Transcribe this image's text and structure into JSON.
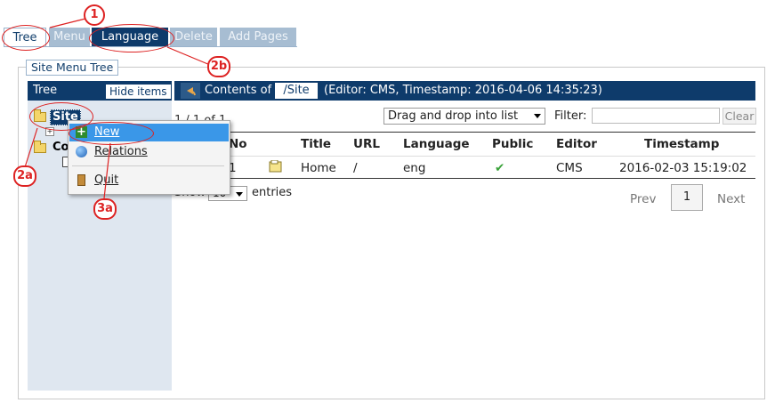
{
  "tabs": [
    {
      "label": "Tree"
    },
    {
      "label": "Menu"
    },
    {
      "label": "Language"
    },
    {
      "label": "Delete"
    },
    {
      "label": "Add Pages"
    }
  ],
  "panel": {
    "legend": "Site Menu Tree"
  },
  "sidebar": {
    "title": "Tree",
    "hide_button": "Hide items"
  },
  "tree": {
    "root": "Site",
    "second": "Co"
  },
  "contents": {
    "prefix": "Contents of",
    "path": "/Site",
    "suffix": "(Editor: CMS, Timestamp: 2016-04-06 14:35:23)"
  },
  "toolbar": {
    "count": "1 / 1 of 1",
    "mode_select": "Drag and drop into list",
    "filter_label": "Filter:",
    "filter_value": "",
    "clear_button": "Clear"
  },
  "table": {
    "columns": [
      "No",
      "Title",
      "URL",
      "Language",
      "Public",
      "Editor",
      "Timestamp"
    ],
    "rows": [
      {
        "no": "1",
        "title": "Home",
        "url": "/",
        "language": "eng",
        "public": "✔",
        "editor": "CMS",
        "timestamp": "2016-02-03 15:19:02"
      }
    ]
  },
  "footer": {
    "show": "Show",
    "length": "10",
    "entries": "entries",
    "prev": "Prev",
    "page": "1",
    "next": "Next"
  },
  "context_menu": {
    "items": [
      {
        "label": "New",
        "icon": "plus-icon"
      },
      {
        "label": "Relations",
        "icon": "globe-icon"
      },
      {
        "label": "Quit",
        "icon": "door-icon"
      }
    ]
  },
  "annotations": [
    "1",
    "2a",
    "2b",
    "3a"
  ],
  "colors": {
    "header": "#0e3b6b",
    "highlight": "#3a97e8",
    "annotation": "#d22"
  }
}
